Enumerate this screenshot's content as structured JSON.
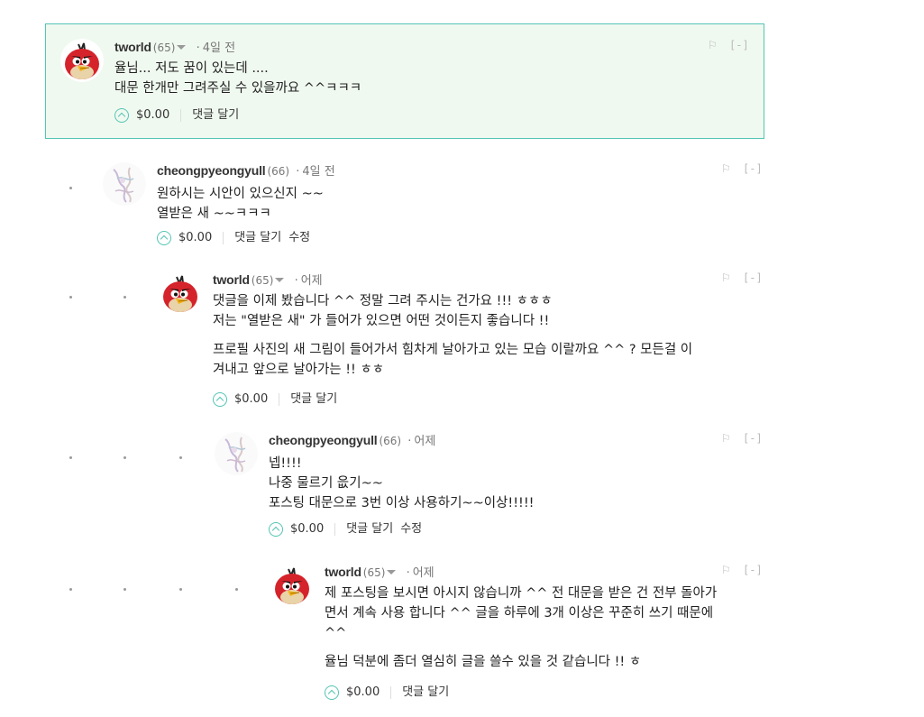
{
  "comments": [
    {
      "author": "tworld",
      "reputation": "(65)",
      "separator": "·",
      "time": "4일 전",
      "lines": [
        "율님... 저도 꿈이 있는데 ....",
        "대문 한개만 그려주실 수 있을까요 ^^ㅋㅋㅋ"
      ],
      "payout": "$0.00",
      "reply": "댓글 달기",
      "collapse": "[-]",
      "avatar": "angry-bird"
    },
    {
      "author": "cheongpyeongyull",
      "reputation": "(66)",
      "separator": "·",
      "time": "4일 전",
      "lines": [
        "원하시는 시안이 있으신지 ~~",
        "열받은 새 ~~ㅋㅋㅋ"
      ],
      "payout": "$0.00",
      "reply": "댓글 달기",
      "edit": "수정",
      "collapse": "[-]",
      "avatar": "sketch"
    },
    {
      "author": "tworld",
      "reputation": "(65)",
      "separator": "·",
      "time": "어제",
      "lines": [
        "댓글을 이제 봤습니다 ^^ 정말 그려 주시는 건가요 !!! ㅎㅎㅎ",
        "저는 \"열받은 새\" 가 들어가 있으면 어떤 것이든지 좋습니다 !!"
      ],
      "lines2": [
        "프로필 사진의 새 그림이 들어가서 힘차게 날아가고 있는 모습 이랄까요 ^^ ? 모든걸 이",
        "겨내고 앞으로 날아가는 !! ㅎㅎ"
      ],
      "payout": "$0.00",
      "reply": "댓글 달기",
      "collapse": "[-]",
      "avatar": "angry-bird"
    },
    {
      "author": "cheongpyeongyull",
      "reputation": "(66)",
      "separator": "·",
      "time": "어제",
      "lines": [
        "넵!!!!",
        "나중 물르기 읎기~~",
        "포스팅 대문으로 3번 이상 사용하기~~이상!!!!!"
      ],
      "payout": "$0.00",
      "reply": "댓글 달기",
      "edit": "수정",
      "collapse": "[-]",
      "avatar": "sketch"
    },
    {
      "author": "tworld",
      "reputation": "(65)",
      "separator": "·",
      "time": "어제",
      "lines": [
        "제 포스팅을 보시면 아시지 않습니까 ^^ 전 대문을 받은 건 전부 돌아가",
        "면서 계속 사용 합니다 ^^ 글을 하루에 3개 이상은 꾸준히 쓰기 때문에",
        "^^"
      ],
      "lines2": [
        "율님 덕분에 좀더 열심히 글을 쓸수 있을 것 같습니다 !! ㅎ"
      ],
      "payout": "$0.00",
      "reply": "댓글 달기",
      "collapse": "[-]",
      "avatar": "angry-bird"
    }
  ],
  "colors": {
    "accent": "#53c5b5",
    "highlight_bg": "#f0f9f0",
    "text": "#222222",
    "muted": "#777777"
  },
  "icons": {
    "flag": "flag-icon",
    "vote": "upvote-icon",
    "dropdown": "caret-down-icon"
  }
}
